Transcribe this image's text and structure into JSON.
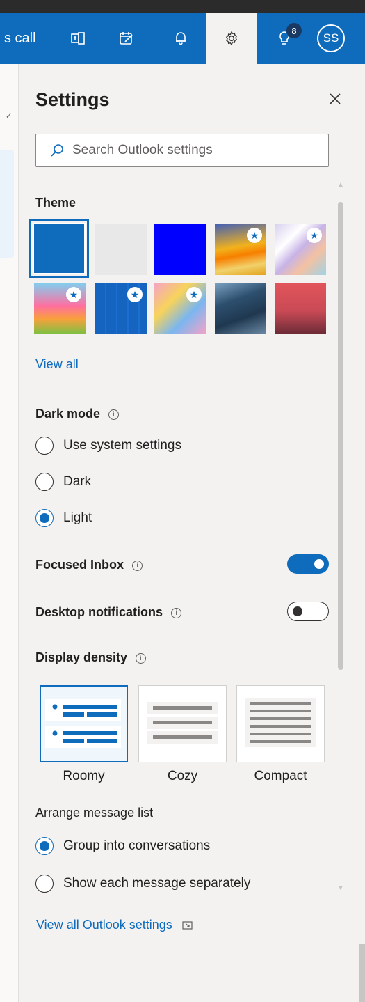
{
  "topbar": {
    "partial_text": "s call",
    "tips_badge": "8",
    "avatar_initials": "SS"
  },
  "settings": {
    "title": "Settings",
    "search_placeholder": "Search Outlook settings",
    "theme": {
      "label": "Theme",
      "view_all": "View all",
      "items": [
        {
          "name": "blue",
          "color": "#0f6cbd",
          "selected": true,
          "premium": false
        },
        {
          "name": "light-gray",
          "color": "#e8e8e8",
          "selected": false,
          "premium": false
        },
        {
          "name": "bright-blue",
          "color": "#0000ff",
          "selected": false,
          "premium": false
        },
        {
          "name": "sunset-waves",
          "color": "#f2b21c",
          "selected": false,
          "premium": true
        },
        {
          "name": "pastel-ribbons",
          "color": "#c7b3e6",
          "selected": false,
          "premium": true
        },
        {
          "name": "fireworks-pig",
          "color": "#ff6fa0",
          "selected": false,
          "premium": true
        },
        {
          "name": "blueprint",
          "color": "#1565c0",
          "selected": false,
          "premium": true
        },
        {
          "name": "colorful-board",
          "color": "#f5a3c7",
          "selected": false,
          "premium": true
        },
        {
          "name": "ocean-rock",
          "color": "#2d4f6e",
          "selected": false,
          "premium": false
        },
        {
          "name": "palm-sunset",
          "color": "#e2555a",
          "selected": false,
          "premium": false
        }
      ]
    },
    "dark_mode": {
      "label": "Dark mode",
      "options": [
        {
          "label": "Use system settings",
          "checked": false
        },
        {
          "label": "Dark",
          "checked": false
        },
        {
          "label": "Light",
          "checked": true
        }
      ]
    },
    "focused_inbox": {
      "label": "Focused Inbox",
      "on": true
    },
    "desktop_notifications": {
      "label": "Desktop notifications",
      "on": false
    },
    "display_density": {
      "label": "Display density",
      "options": [
        {
          "label": "Roomy",
          "selected": true
        },
        {
          "label": "Cozy",
          "selected": false
        },
        {
          "label": "Compact",
          "selected": false
        }
      ]
    },
    "arrange": {
      "label": "Arrange message list",
      "options": [
        {
          "label": "Group into conversations",
          "checked": true
        },
        {
          "label": "Show each message separately",
          "checked": false
        }
      ]
    },
    "view_all_settings": "View all Outlook settings"
  },
  "colors": {
    "accent": "#0f6cbd",
    "panel_bg": "#f3f2f1",
    "topbar": "#0f6cbd"
  }
}
